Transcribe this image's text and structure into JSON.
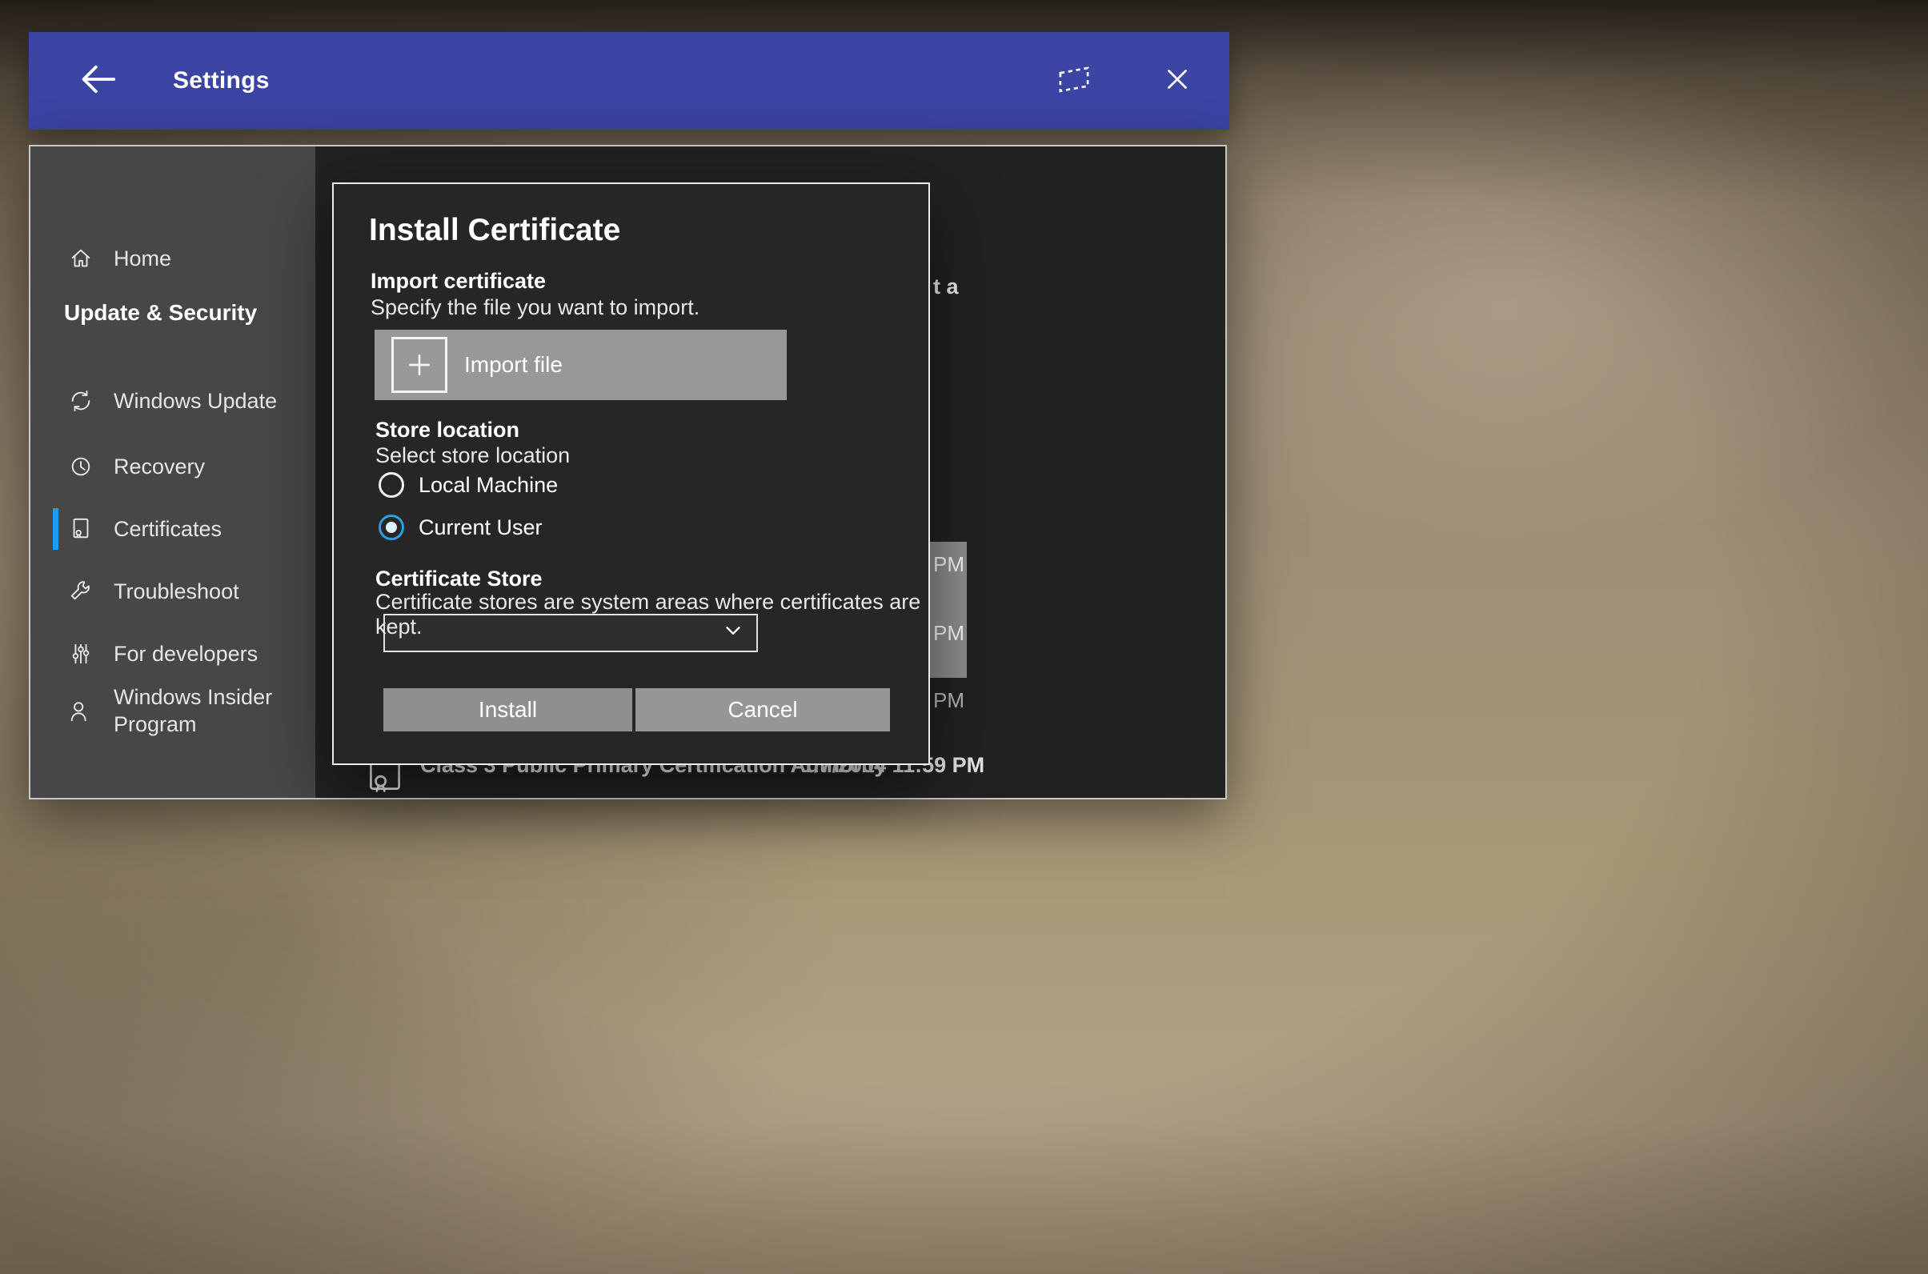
{
  "colors": {
    "titlebar": "#3c44a4",
    "accent": "#1f9cea",
    "radio_accent": "#2b9fe0",
    "window_bg": "#2a2a2a",
    "sidebar_bg": "#474747",
    "dialog_bg": "#262626"
  },
  "titlebar": {
    "title": "Settings"
  },
  "icons": {
    "back": "back-arrow-icon",
    "follow": "window-follow-icon",
    "close": "close-icon",
    "plus": "plus-icon",
    "chevron": "chevron-down-icon",
    "certificate_row": "certificate-icon"
  },
  "sidebar": {
    "items": [
      {
        "label": "Home",
        "icon": "home-icon",
        "selected": false
      },
      {
        "label": "Update & Security",
        "icon": null,
        "header": true
      },
      {
        "label": "Windows Update",
        "icon": "sync-icon",
        "selected": false
      },
      {
        "label": "Recovery",
        "icon": "history-clock-icon",
        "selected": false
      },
      {
        "label": "Certificates",
        "icon": "certificate-icon",
        "selected": true
      },
      {
        "label": "Troubleshoot",
        "icon": "wrench-icon",
        "selected": false
      },
      {
        "label": "For developers",
        "icon": "sliders-icon",
        "selected": false
      },
      {
        "label": "Windows Insider Program",
        "icon": "person-icon",
        "selected": false
      }
    ]
  },
  "dialog": {
    "title": "Install Certificate",
    "import_section": {
      "heading": "Import certificate",
      "description": "Specify the file you want to import.",
      "button_label": "Import file"
    },
    "store_location": {
      "heading": "Store location",
      "description": "Select store location",
      "options": [
        {
          "label": "Local Machine",
          "selected": false
        },
        {
          "label": "Current User",
          "selected": true
        }
      ]
    },
    "certificate_store": {
      "heading": "Certificate Store",
      "description": "Certificate stores are system areas where certificates are kept.",
      "value": ""
    },
    "actions": {
      "install": "Install",
      "cancel": "Cancel"
    }
  },
  "background_page": {
    "top_fragment": "t a",
    "time_fragments": [
      "PM",
      "PM",
      "PM"
    ],
    "certificate_row": {
      "name": "Class 3 Public Primary Certification Authority",
      "date": "1/7/2004 11:59 PM"
    }
  }
}
